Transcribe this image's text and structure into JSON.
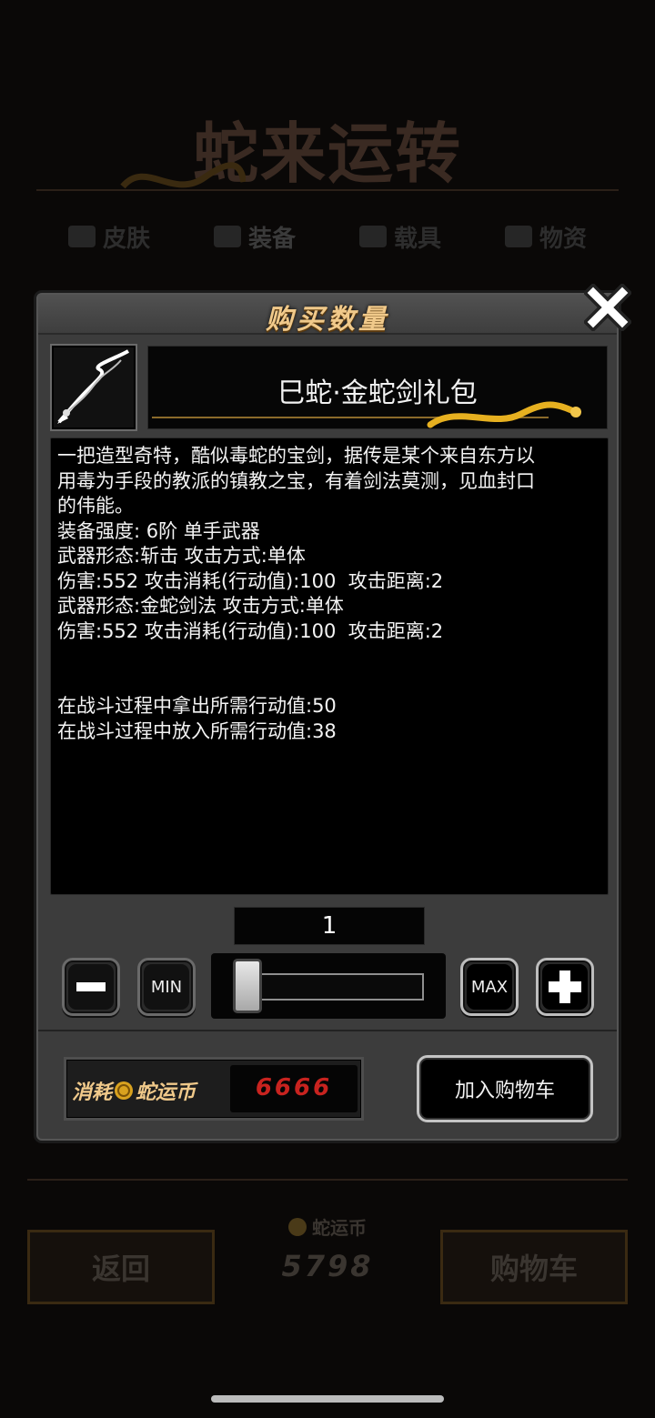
{
  "background": {
    "title": "蛇来运转",
    "tabs": [
      {
        "label": "皮肤",
        "icon": "box-icon"
      },
      {
        "label": "装备",
        "icon": "shield-icon"
      },
      {
        "label": "载具",
        "icon": "car-icon"
      },
      {
        "label": "物资",
        "icon": "crate-icon"
      }
    ],
    "active_tab": "装备",
    "back_label": "返回",
    "coin_label": "蛇运币",
    "coin_balance": "5798",
    "cart_label": "购物车"
  },
  "modal": {
    "title": "购买数量",
    "close_icon": "close-icon",
    "item": {
      "icon": "snake-sword-icon",
      "name": "巳蛇·金蛇剑礼包",
      "description_lines": [
        "一把造型奇特，酷似毒蛇的宝剑，据传是某个来自东方以",
        "用毒为手段的教派的镇教之宝，有着剑法莫测，见血封口",
        "的伟能。",
        "装备强度: 6阶 单手武器",
        "武器形态:斩击 攻击方式:单体",
        "伤害:552 攻击消耗(行动值):100  攻击距离:2",
        "武器形态:金蛇剑法 攻击方式:单体",
        "伤害:552 攻击消耗(行动值):100  攻击距离:2",
        "",
        "",
        "在战斗过程中拿出所需行动值:50",
        "在战斗过程中放入所需行动值:38"
      ]
    },
    "quantity": "1",
    "quantity_fraction": 0.0,
    "min_label": "MIN",
    "max_label": "MAX",
    "cost_prefix": "消耗",
    "cost_currency": "蛇运币",
    "cost_value": "6666",
    "add_to_cart_label": "加入购物车"
  },
  "colors": {
    "gold_text": "#f0c98a",
    "cost_red": "#c8231f",
    "panel": "#3c3c3c"
  }
}
